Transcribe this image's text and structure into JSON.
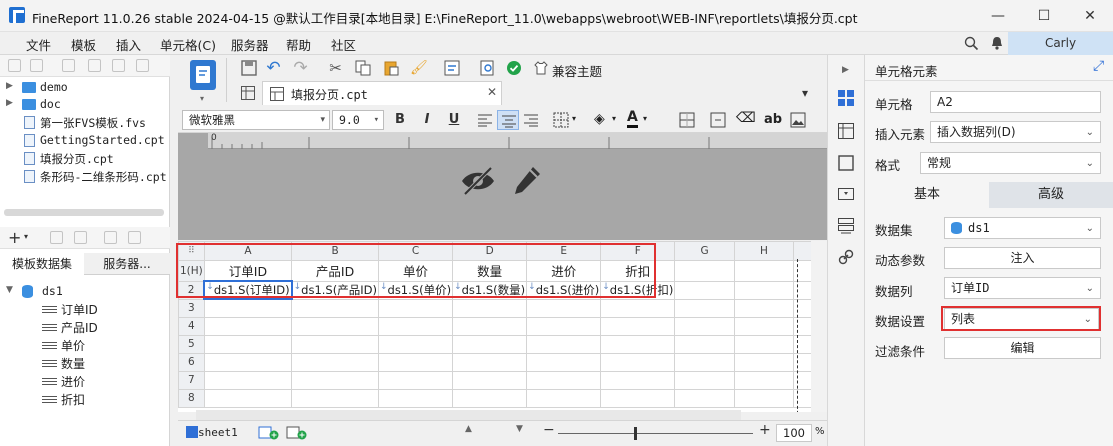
{
  "window": {
    "title": "FineReport 11.0.26 stable 2024-04-15 @默认工作目录[本地目录]    E:\\FineReport_11.0\\webapps\\webroot\\WEB-INF\\reportlets\\填报分页.cpt",
    "controls": {
      "minimize": "—",
      "maximize": "☐",
      "close": "✕"
    }
  },
  "menu": {
    "items": [
      "文件",
      "模板",
      "插入",
      "单元格(C)",
      "服务器",
      "帮助",
      "社区"
    ],
    "user": "Carly"
  },
  "file_tree": {
    "items": [
      {
        "label": "demo",
        "type": "folder"
      },
      {
        "label": "doc",
        "type": "folder"
      },
      {
        "label": "第一张FVS模板.fvs",
        "type": "file"
      },
      {
        "label": "GettingStarted.cpt",
        "type": "file"
      },
      {
        "label": "填报分页.cpt",
        "type": "file"
      },
      {
        "label": "条形码-二维条形码.cpt",
        "type": "file"
      }
    ]
  },
  "dataset_panel": {
    "tabs": [
      "模板数据集",
      "服务器..."
    ],
    "dataset": "ds1",
    "fields": [
      "订单ID",
      "产品ID",
      "单价",
      "数量",
      "进价",
      "折扣"
    ]
  },
  "toolbar": {
    "compat_theme": "兼容主题",
    "file_tab": "填报分页.cpt",
    "font": "微软雅黑",
    "font_size": "9.0",
    "bold": "B",
    "italic": "I",
    "underline": "U",
    "text_color_label": "A",
    "ab_label": "ab"
  },
  "sheet": {
    "columns": [
      "A",
      "B",
      "C",
      "D",
      "E",
      "F",
      "G",
      "H"
    ],
    "row_labels": [
      "1(H)",
      "2",
      "3",
      "4",
      "5",
      "6",
      "7",
      "8"
    ],
    "title_row": [
      "订单ID",
      "产品ID",
      "单价",
      "数量",
      "进价",
      "折扣"
    ],
    "data_row": [
      "ds1.S(订单ID)",
      "ds1.S(产品ID)",
      "ds1.S(单价)",
      "ds1.S(数量)",
      "ds1.S(进价)",
      "ds1.S(折扣)"
    ],
    "sheet_tab": "sheet1",
    "zoom": "100",
    "zoom_unit": "%"
  },
  "cell_element_panel": {
    "title": "单元格元素",
    "cell_label": "单元格",
    "cell_value": "A2",
    "insert_label": "插入元素",
    "insert_value": "插入数据列(D)",
    "format_label": "格式",
    "format_value": "常规",
    "tabs": {
      "basic": "基本",
      "advanced": "高级"
    },
    "dataset_label": "数据集",
    "dataset_value": "ds1",
    "dynamic_params_label": "动态参数",
    "dynamic_params_button": "注入",
    "column_label": "数据列",
    "column_value": "订单ID",
    "data_setting_label": "数据设置",
    "data_setting_value": "列表",
    "filter_label": "过滤条件",
    "filter_button": "编辑"
  },
  "colors": {
    "highlight_red": "#e03030",
    "selection_blue": "#2f6fd6",
    "user_bg": "#cfe2f5",
    "advanced_tab_bg": "#dfe3e8"
  }
}
